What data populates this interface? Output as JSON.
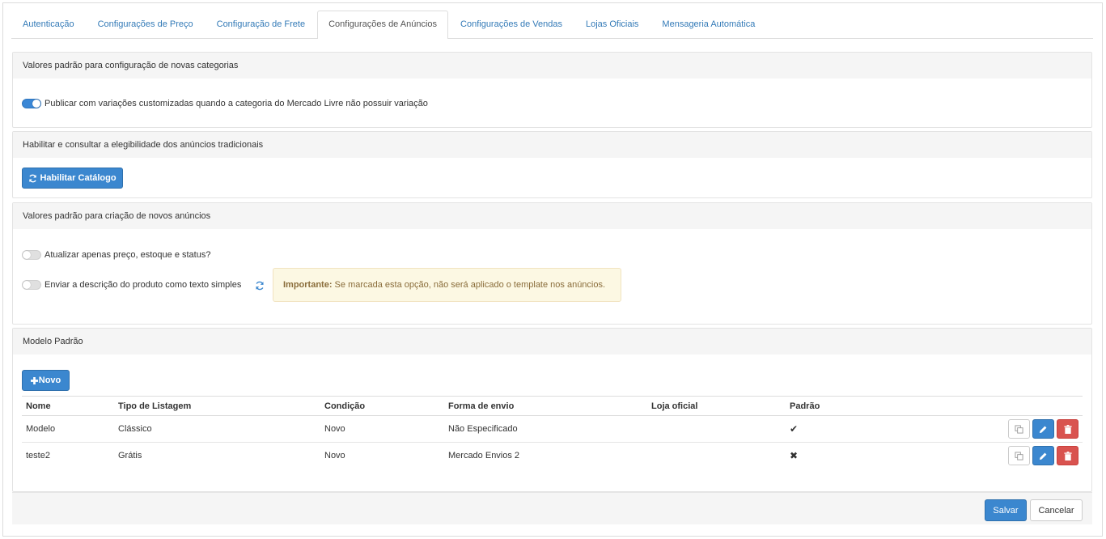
{
  "tabs": [
    {
      "label": "Autenticação"
    },
    {
      "label": "Configurações de Preço"
    },
    {
      "label": "Configuração de Frete"
    },
    {
      "label": "Configurações de Anúncios"
    },
    {
      "label": "Configurações de Vendas"
    },
    {
      "label": "Lojas Oficiais"
    },
    {
      "label": "Mensageria Automática"
    }
  ],
  "active_tab": "Configurações de Anúncios",
  "section_categories": {
    "title": "Valores padrão para configuração de novas categorias",
    "toggle_label": "Publicar com variações customizadas quando a categoria do Mercado Livre não possuir variação",
    "toggle_on": true
  },
  "section_catalog": {
    "title": "Habilitar e consultar a elegibilidade dos anúncios tradicionais",
    "button_label": "Habilitar Catálogo"
  },
  "section_new_ads": {
    "title": "Valores padrão para criação de novos anúncios",
    "toggle1_label": "Atualizar apenas preço, estoque e status?",
    "toggle2_label": "Enviar a descrição do produto como texto simples",
    "alert_strong": "Importante:",
    "alert_text": " Se marcada esta opção, não será aplicado o template nos anúncios."
  },
  "section_model": {
    "title": "Modelo Padrão",
    "new_button_label": "Novo",
    "columns": [
      "Nome",
      "Tipo de Listagem",
      "Condição",
      "Forma de envio",
      "Loja oficial",
      "Padrão"
    ],
    "rows": [
      {
        "nome": "Modelo",
        "tipo": "Clássico",
        "condicao": "Novo",
        "envio": "Não Especificado",
        "loja": "",
        "padrao": "✔"
      },
      {
        "nome": "teste2",
        "tipo": "Grátis",
        "condicao": "Novo",
        "envio": "Mercado Envios 2",
        "loja": "",
        "padrao": "✖"
      }
    ]
  },
  "footer": {
    "save_label": "Salvar",
    "cancel_label": "Cancelar"
  },
  "colors": {
    "primary": "#3b87cf",
    "danger": "#d9534f",
    "link": "#337ab7",
    "alert_bg": "#fcf8e3"
  }
}
